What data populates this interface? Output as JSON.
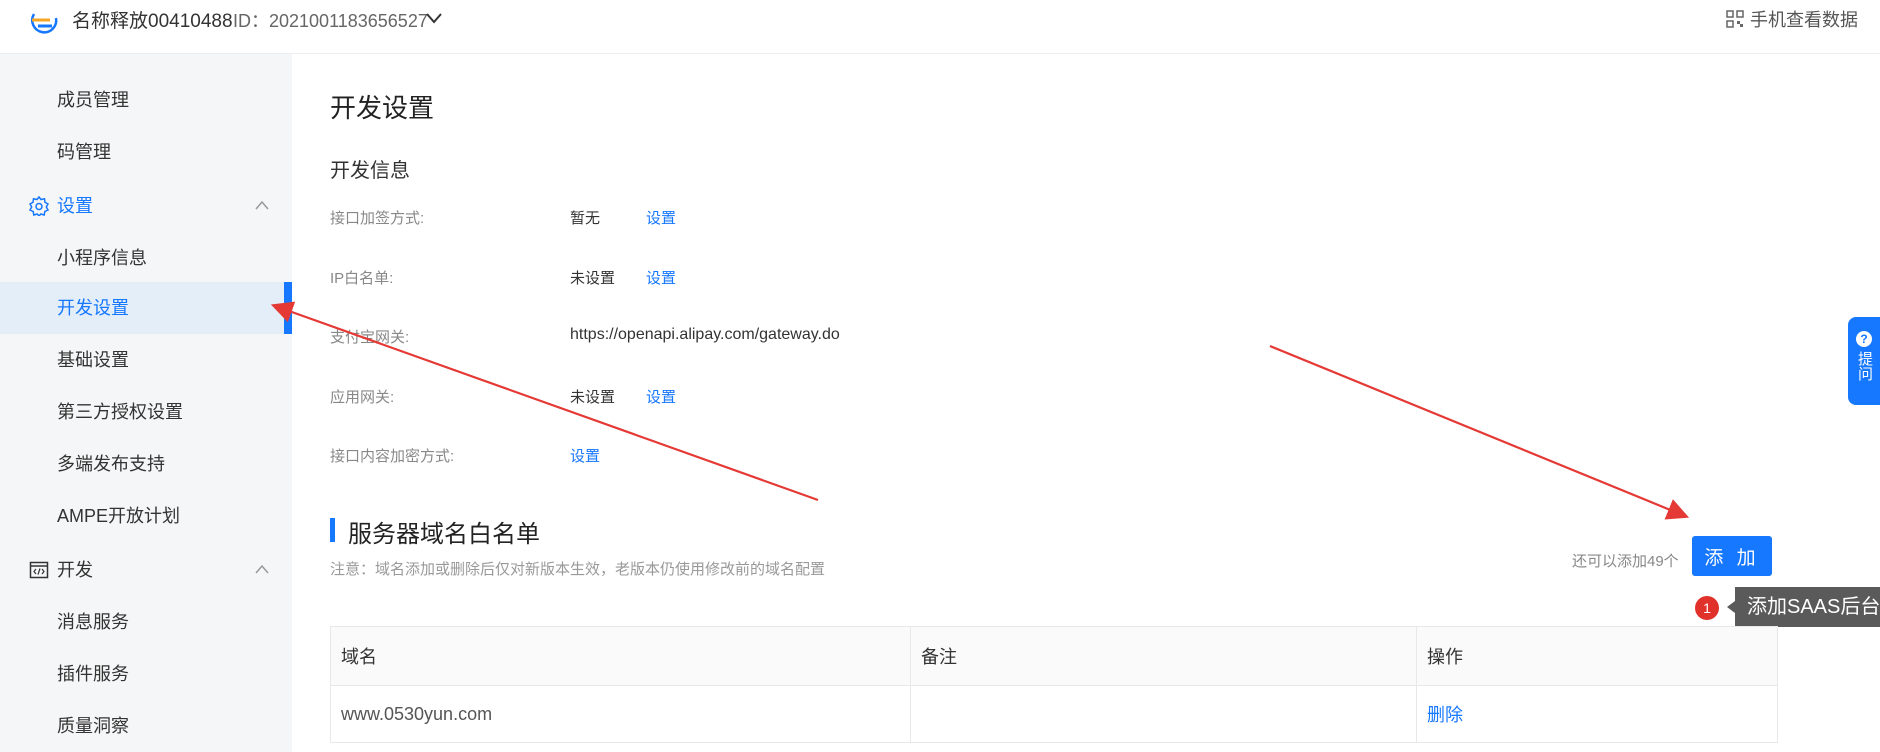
{
  "header": {
    "app_name": "名称释放00410488",
    "app_id": "ID：2021001183656527",
    "mobile_link": "手机查看数据"
  },
  "sidebar": {
    "items_top": [
      {
        "label": "成员管理"
      },
      {
        "label": "码管理"
      }
    ],
    "group_settings": {
      "label": "设置",
      "icon": "gear-icon"
    },
    "settings_items": [
      {
        "label": "小程序信息"
      },
      {
        "label": "开发设置",
        "active": true
      },
      {
        "label": "基础设置"
      },
      {
        "label": "第三方授权设置"
      },
      {
        "label": "多端发布支持"
      },
      {
        "label": "AMPE开放计划"
      }
    ],
    "group_dev": {
      "label": "开发",
      "icon": "code-icon"
    },
    "dev_items": [
      {
        "label": "消息服务"
      },
      {
        "label": "插件服务"
      },
      {
        "label": "质量洞察"
      }
    ]
  },
  "main": {
    "title": "开发设置",
    "dev_info": {
      "title": "开发信息",
      "rows": [
        {
          "label": "接口加签方式:",
          "value": "暂无",
          "link": "设置"
        },
        {
          "label": "IP白名单:",
          "value": "未设置",
          "link": "设置"
        },
        {
          "label": "支付宝网关:",
          "value": "https://openapi.alipay.com/gateway.do",
          "link": ""
        },
        {
          "label": "应用网关:",
          "value": "未设置",
          "link": "设置"
        },
        {
          "label": "接口内容加密方式:",
          "value": "",
          "link": "设置"
        }
      ]
    },
    "whitelist": {
      "title": "服务器域名白名单",
      "note": "注意：域名添加或删除后仅对新版本生效，老版本仍使用修改前的域名配置",
      "remaining": "还可以添加49个",
      "add_label": "添 加",
      "table": {
        "headers": [
          "域名",
          "备注",
          "操作"
        ],
        "rows": [
          {
            "domain": "www.0530yun.com",
            "remark": "",
            "action": "删除"
          }
        ]
      }
    },
    "tooltip": {
      "badge": "1",
      "text": "添加SAAS后台域名"
    }
  },
  "help_tab": {
    "label": "提问"
  },
  "colors": {
    "accent": "#1677ff",
    "arrow": "#e53935",
    "sidebar_bg": "#f5f6f7",
    "active_bg": "#e3eef9"
  }
}
